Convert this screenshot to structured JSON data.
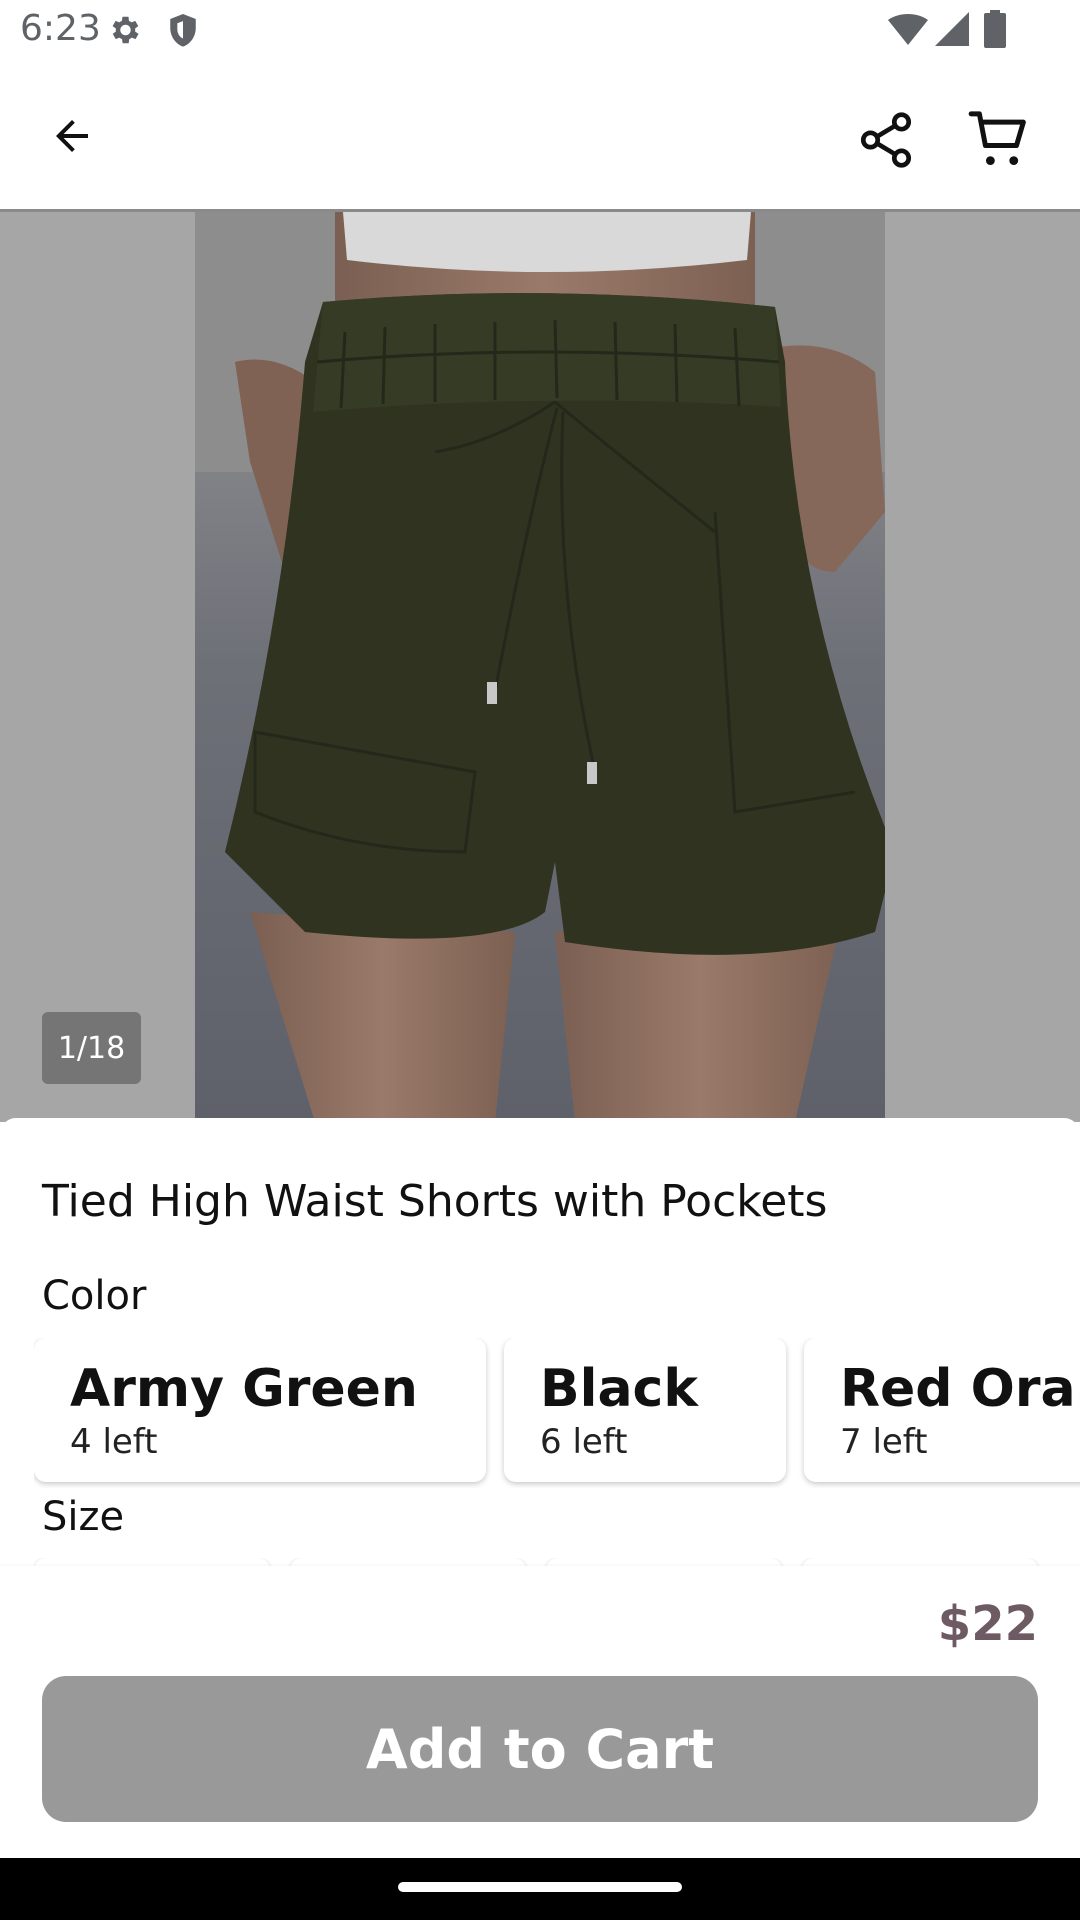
{
  "status_bar": {
    "time": "6:23",
    "icons": [
      "settings-gear-icon",
      "shield-icon",
      "wifi-icon",
      "cell-signal-icon",
      "battery-icon"
    ]
  },
  "app_bar": {
    "icons": [
      "back-arrow-icon",
      "share-icon",
      "shopping-cart-icon"
    ]
  },
  "gallery": {
    "counter": "1/18"
  },
  "product": {
    "title": "Tied High Waist Shorts with Pockets",
    "color_label": "Color",
    "colors": [
      {
        "name": "Army Green",
        "stock": "4 left"
      },
      {
        "name": "Black",
        "stock": "6 left"
      },
      {
        "name": "Red Orange",
        "stock": "7 left"
      }
    ],
    "size_label": "Size"
  },
  "footer": {
    "price": "$22",
    "add_to_cart": "Add to Cart"
  },
  "colors": {
    "price": "#6d5a63",
    "button_disabled": "#999999",
    "shorts": "#2f331f"
  }
}
